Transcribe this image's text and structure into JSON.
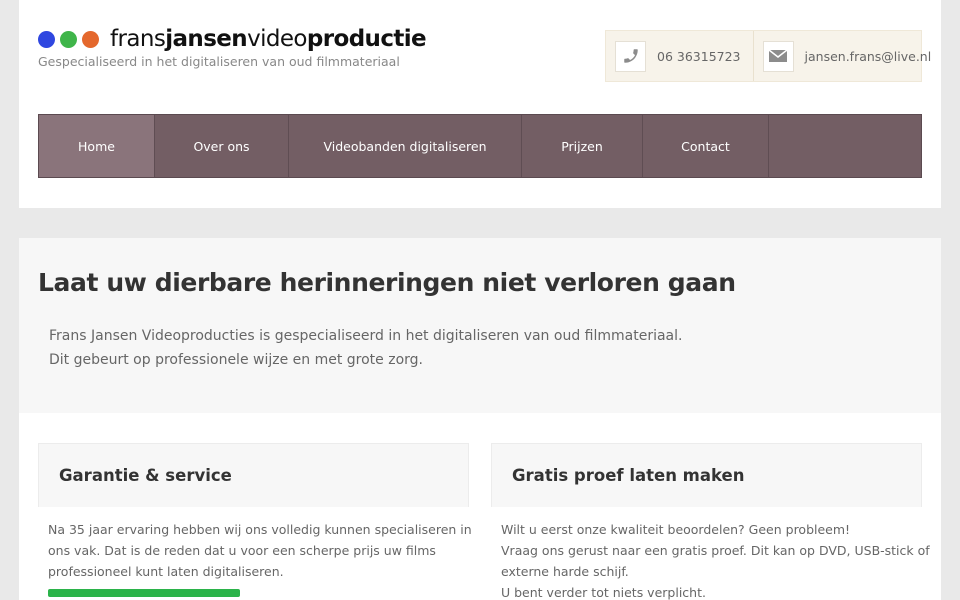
{
  "brand": {
    "dots": [
      "#2f47e0",
      "#3fb54a",
      "#e4682d"
    ],
    "name_parts": [
      "frans",
      "jansen",
      "video",
      "productie"
    ],
    "tagline": "Gespecialiseerd in het digitaliseren van oud filmmateriaal"
  },
  "contact": {
    "phone": "06 36315723",
    "email": "jansen.frans@live.nl"
  },
  "nav": {
    "items": [
      {
        "label": "Home",
        "active": true
      },
      {
        "label": "Over ons"
      },
      {
        "label": "Videobanden digitaliseren"
      },
      {
        "label": "Prijzen"
      },
      {
        "label": "Contact"
      }
    ]
  },
  "hero": {
    "title": "Laat uw dierbare herinneringen niet verloren gaan",
    "line1": "Frans Jansen Videoproducties is gespecialiseerd in het digitaliseren van oud filmmateriaal.",
    "line2": "Dit gebeurt op professionele wijze en met grote zorg."
  },
  "boxes": [
    {
      "title": "Garantie & service",
      "lines": [
        "Na 35 jaar ervaring hebben wij ons volledig kunnen specialiseren in",
        "ons vak. Dat is de reden dat u voor een scherpe prijs uw films",
        "professioneel kunt laten digitaliseren."
      ]
    },
    {
      "title": "Gratis proef laten maken",
      "lines": [
        "Wilt u eerst onze kwaliteit beoordelen? Geen probleem!",
        "Vraag ons gerust naar een gratis proef. Dit kan op DVD, USB-stick of",
        "externe harde schijf.",
        "U bent verder tot niets verplicht."
      ]
    }
  ]
}
